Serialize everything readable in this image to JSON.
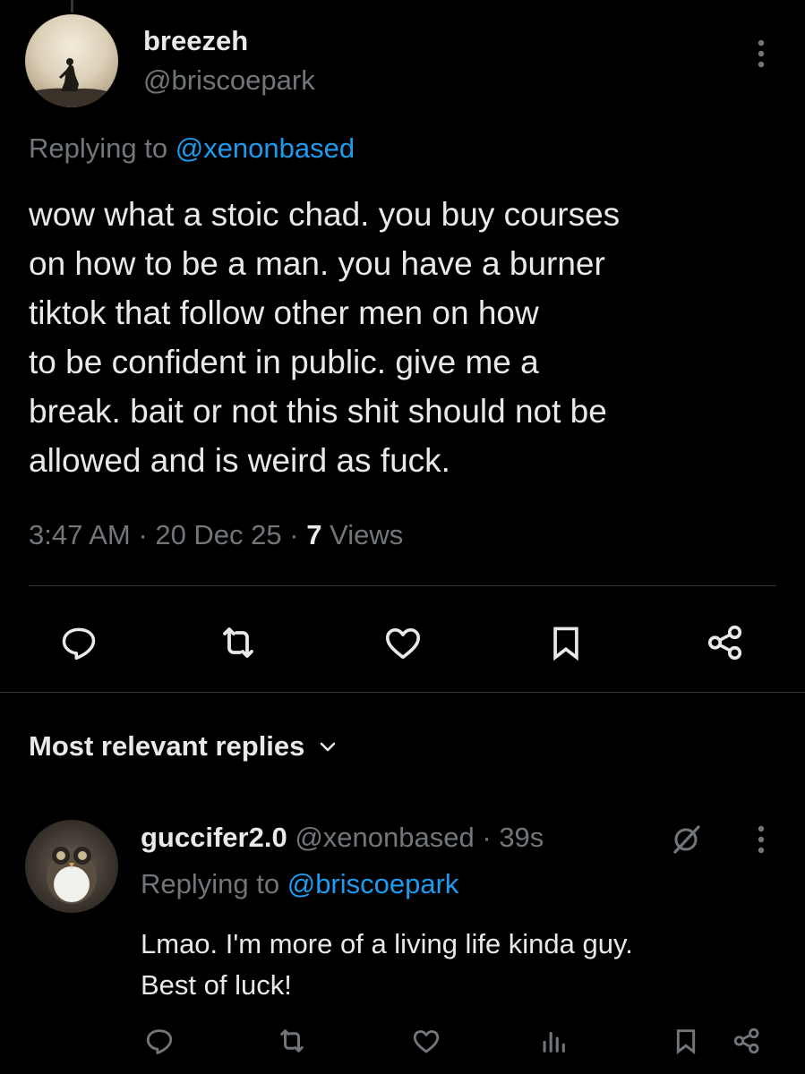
{
  "tweet": {
    "author_name": "breezeh",
    "author_handle": "@briscoepark",
    "replying_prefix": "Replying to ",
    "replying_to": "@xenonbased",
    "text": "wow what a stoic chad. you buy courses\non how to be a man. you have a burner\ntiktok that follow other men on how\nto be confident in public. give me a\nbreak. bait or not this shit should not be\nallowed and is weird as fuck.",
    "time": "3:47 AM",
    "date": "20 Dec 25",
    "separator": "·",
    "views_count": "7",
    "views_label": "Views"
  },
  "replies_section": {
    "sort_label": "Most relevant replies"
  },
  "reply": {
    "author_name": "guccifer2.0",
    "author_handle": "@xenonbased",
    "separator": "·",
    "age": "39s",
    "replying_prefix": "Replying to ",
    "replying_to": "@briscoepark",
    "text": "Lmao. I'm more of a living life kinda guy.\nBest of luck!"
  },
  "icons": {
    "reply": "reply-icon",
    "retweet": "retweet-icon",
    "like": "heart-icon",
    "bookmark": "bookmark-icon",
    "share": "share-icon",
    "views": "views-icon",
    "grok": "grok-icon",
    "more": "more-vertical-icon",
    "chevron": "chevron-down-icon"
  },
  "colors": {
    "background": "#000000",
    "text": "#e7e9ea",
    "secondary": "#71767b",
    "link": "#1d9bf0",
    "divider": "#2f3336"
  }
}
